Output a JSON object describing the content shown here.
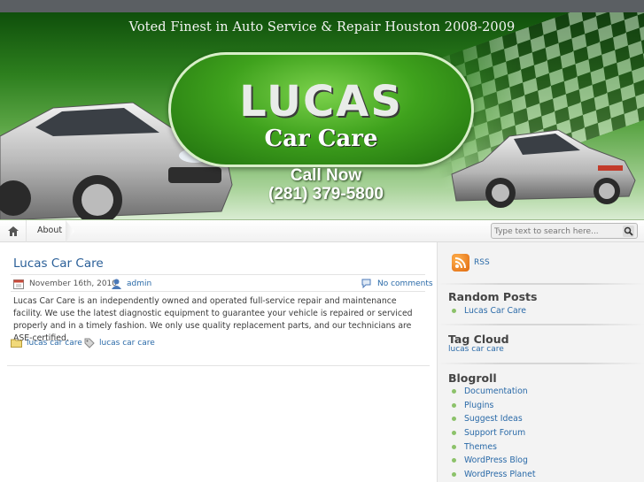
{
  "header": {
    "tagline": "Voted Finest in Auto Service & Repair Houston 2008-2009",
    "logo_main": "LUCAS",
    "logo_sub": "Car Care",
    "call_now": "Call Now",
    "phone": "(281) 379-5800"
  },
  "nav": {
    "home_icon": "home-icon",
    "items": [
      {
        "label": "About"
      }
    ],
    "search_placeholder": "Type text to search here..."
  },
  "post": {
    "title": "Lucas Car Care",
    "date": "November 16th, 2010",
    "author": "admin",
    "comments": "No comments",
    "body": "Lucas Car Care is an independently owned and operated full-service repair and maintenance facility. We use the latest diagnostic equipment to guarantee your vehicle is repaired or serviced properly and in a timely fashion. We only use quality replacement parts, and our technicians are ASE-certified.",
    "category": "lucas car care",
    "tag": "lucas car care"
  },
  "sidebar": {
    "rss_label": "RSS",
    "random_posts": {
      "heading": "Random Posts",
      "items": [
        "Lucas Car Care"
      ]
    },
    "tag_cloud": {
      "heading": "Tag Cloud",
      "tags": [
        "lucas car care"
      ]
    },
    "blogroll": {
      "heading": "Blogroll",
      "items": [
        "Documentation",
        "Plugins",
        "Suggest Ideas",
        "Support Forum",
        "Themes",
        "WordPress Blog",
        "WordPress Planet"
      ]
    }
  },
  "colors": {
    "link": "#2a6aa8",
    "banner_green": "#2d7f1e",
    "bullet": "#8cc26a"
  }
}
